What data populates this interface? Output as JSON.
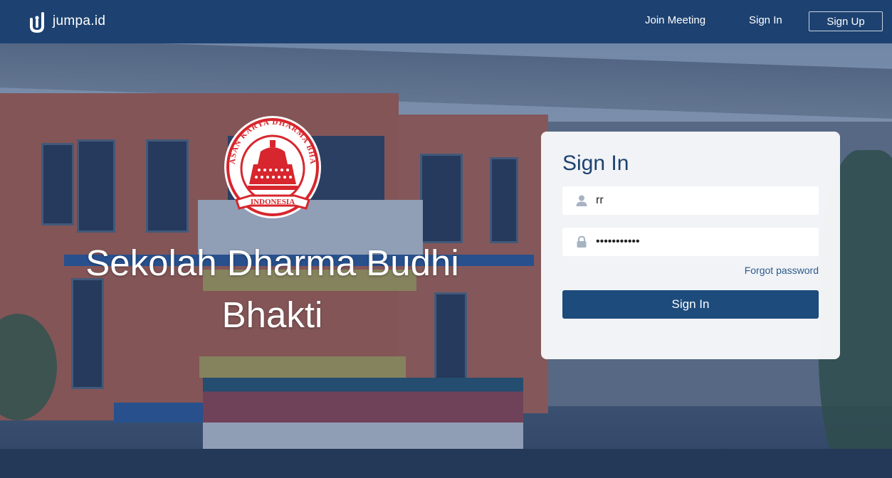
{
  "brand": {
    "name": "jumpa.id",
    "icon": "jumpa-logo-icon"
  },
  "nav": {
    "join_meeting": "Join Meeting",
    "sign_in": "Sign In",
    "sign_up": "Sign Up"
  },
  "school": {
    "name": "Sekolah Dharma Budhi Bhakti",
    "crest": {
      "top_text": "YAYASAN KARYA DHARMA BHAKTI",
      "ribbon_text": "INDONESIA"
    }
  },
  "login": {
    "title": "Sign In",
    "username": {
      "value": "rr",
      "icon": "user-icon"
    },
    "password": {
      "value": "•••••••••••",
      "icon": "lock-icon"
    },
    "forgot_password": "Forgot password",
    "submit_label": "Sign In"
  },
  "colors": {
    "header_bg": "#1d4271",
    "primary_button": "#1d4b7c",
    "title_text": "#1d4271",
    "crest_red": "#d7262d"
  }
}
